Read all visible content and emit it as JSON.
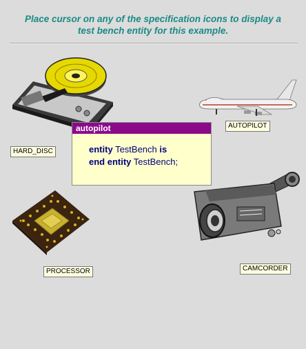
{
  "instruction": {
    "line1": "Place cursor on any of the specification icons to display a",
    "line2": "test bench entity for this example."
  },
  "icons": {
    "hard_disc": "HARD_DISC",
    "autopilot": "AUTOPILOT",
    "processor": "PROCESSOR",
    "camcorder": "CAMCORDER"
  },
  "tooltip": {
    "title": "autopilot",
    "line1_kw": "entity",
    "line1_name": "TestBench",
    "line1_kw2": "is",
    "line2_kw": "end entity",
    "line2_name": "TestBench;"
  }
}
